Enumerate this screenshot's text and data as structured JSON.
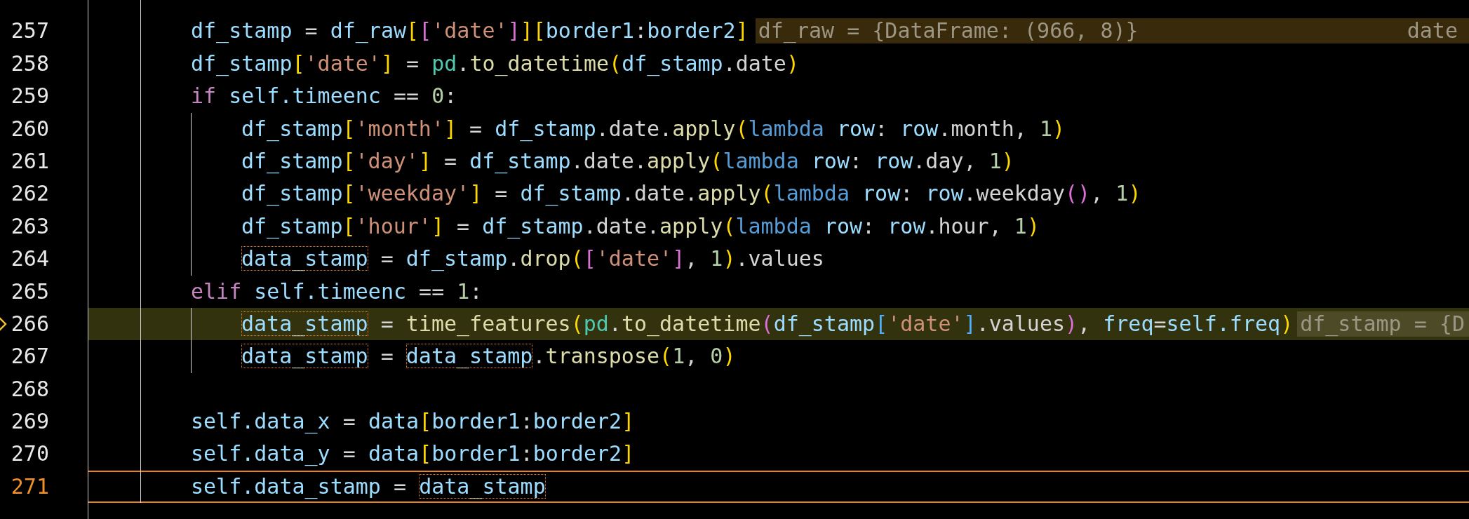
{
  "editor": {
    "lines": [
      {
        "current": false,
        "executing": false
      },
      {
        "number": "257",
        "current": false,
        "executing": false,
        "tokens": [
          {
            "text": "df_stamp",
            "kind": "var"
          },
          {
            "text": " = ",
            "kind": "plain"
          },
          {
            "text": "df_raw",
            "kind": "var"
          },
          {
            "text": "[",
            "kind": "b1"
          },
          {
            "text": "[",
            "kind": "b2"
          },
          {
            "text": "'date'",
            "kind": "str"
          },
          {
            "text": "]",
            "kind": "b2"
          },
          {
            "text": "]",
            "kind": "b1"
          },
          {
            "text": "[",
            "kind": "b1"
          },
          {
            "text": "border1",
            "kind": "var"
          },
          {
            "text": ":",
            "kind": "plain"
          },
          {
            "text": "border2",
            "kind": "var"
          },
          {
            "text": "]",
            "kind": "b1"
          }
        ],
        "hint": {
          "text": "df_raw = {DataFrame: (966, 8)}",
          "trailing": "date"
        }
      },
      {
        "number": "258",
        "current": false,
        "executing": false,
        "tokens": [
          {
            "text": "df_stamp",
            "kind": "var"
          },
          {
            "text": "[",
            "kind": "b1"
          },
          {
            "text": "'date'",
            "kind": "str"
          },
          {
            "text": "]",
            "kind": "b1"
          },
          {
            "text": " = ",
            "kind": "plain"
          },
          {
            "text": "pd",
            "kind": "cls"
          },
          {
            "text": ".",
            "kind": "plain"
          },
          {
            "text": "to_datetime",
            "kind": "fn"
          },
          {
            "text": "(",
            "kind": "b1"
          },
          {
            "text": "df_stamp",
            "kind": "var"
          },
          {
            "text": ".date",
            "kind": "plain"
          },
          {
            "text": ")",
            "kind": "b1"
          }
        ]
      },
      {
        "number": "259",
        "current": false,
        "executing": false,
        "tokens": [
          {
            "text": "if",
            "kind": "kw"
          },
          {
            "text": " self.timeenc",
            "kind": "var"
          },
          {
            "text": " == ",
            "kind": "plain"
          },
          {
            "text": "0",
            "kind": "num"
          },
          {
            "text": ":",
            "kind": "plain"
          }
        ],
        "children": [
          {
            "number": "260",
            "current": false,
            "executing": false,
            "tokens": [
              {
                "text": "df_stamp",
                "kind": "var"
              },
              {
                "text": "[",
                "kind": "b1"
              },
              {
                "text": "'month'",
                "kind": "str"
              },
              {
                "text": "]",
                "kind": "b1"
              },
              {
                "text": " = ",
                "kind": "plain"
              },
              {
                "text": "df_stamp",
                "kind": "var"
              },
              {
                "text": ".date.",
                "kind": "plain"
              },
              {
                "text": "apply",
                "kind": "fn"
              },
              {
                "text": "(",
                "kind": "b1"
              },
              {
                "text": "lambda",
                "kind": "storage"
              },
              {
                "text": " row",
                "kind": "var"
              },
              {
                "text": ": ",
                "kind": "plain"
              },
              {
                "text": "row",
                "kind": "var"
              },
              {
                "text": ".month, ",
                "kind": "plain"
              },
              {
                "text": "1",
                "kind": "num"
              },
              {
                "text": ")",
                "kind": "b1"
              }
            ]
          },
          {
            "number": "261",
            "current": false,
            "executing": false,
            "tokens": [
              {
                "text": "df_stamp",
                "kind": "var"
              },
              {
                "text": "[",
                "kind": "b1"
              },
              {
                "text": "'day'",
                "kind": "str"
              },
              {
                "text": "]",
                "kind": "b1"
              },
              {
                "text": " = ",
                "kind": "plain"
              },
              {
                "text": "df_stamp",
                "kind": "var"
              },
              {
                "text": ".date.",
                "kind": "plain"
              },
              {
                "text": "apply",
                "kind": "fn"
              },
              {
                "text": "(",
                "kind": "b1"
              },
              {
                "text": "lambda",
                "kind": "storage"
              },
              {
                "text": " row",
                "kind": "var"
              },
              {
                "text": ": ",
                "kind": "plain"
              },
              {
                "text": "row",
                "kind": "var"
              },
              {
                "text": ".day, ",
                "kind": "plain"
              },
              {
                "text": "1",
                "kind": "num"
              },
              {
                "text": ")",
                "kind": "b1"
              }
            ]
          },
          {
            "number": "262",
            "current": false,
            "executing": false,
            "tokens": [
              {
                "text": "df_stamp",
                "kind": "var"
              },
              {
                "text": "[",
                "kind": "b1"
              },
              {
                "text": "'weekday'",
                "kind": "str"
              },
              {
                "text": "]",
                "kind": "b1"
              },
              {
                "text": " = ",
                "kind": "plain"
              },
              {
                "text": "df_stamp",
                "kind": "var"
              },
              {
                "text": ".date.",
                "kind": "plain"
              },
              {
                "text": "apply",
                "kind": "fn"
              },
              {
                "text": "(",
                "kind": "b1"
              },
              {
                "text": "lambda",
                "kind": "storage"
              },
              {
                "text": " row",
                "kind": "var"
              },
              {
                "text": ": ",
                "kind": "plain"
              },
              {
                "text": "row",
                "kind": "var"
              },
              {
                "text": ".weekday",
                "kind": "plain"
              },
              {
                "text": "()",
                "kind": "b2"
              },
              {
                "text": ", ",
                "kind": "plain"
              },
              {
                "text": "1",
                "kind": "num"
              },
              {
                "text": ")",
                "kind": "b1"
              }
            ]
          },
          {
            "number": "263",
            "current": false,
            "executing": false,
            "tokens": [
              {
                "text": "df_stamp",
                "kind": "var"
              },
              {
                "text": "[",
                "kind": "b1"
              },
              {
                "text": "'hour'",
                "kind": "str"
              },
              {
                "text": "]",
                "kind": "b1"
              },
              {
                "text": " = ",
                "kind": "plain"
              },
              {
                "text": "df_stamp",
                "kind": "var"
              },
              {
                "text": ".date.",
                "kind": "plain"
              },
              {
                "text": "apply",
                "kind": "fn"
              },
              {
                "text": "(",
                "kind": "b1"
              },
              {
                "text": "lambda",
                "kind": "storage"
              },
              {
                "text": " row",
                "kind": "var"
              },
              {
                "text": ": ",
                "kind": "plain"
              },
              {
                "text": "row",
                "kind": "var"
              },
              {
                "text": ".hour, ",
                "kind": "plain"
              },
              {
                "text": "1",
                "kind": "num"
              },
              {
                "text": ")",
                "kind": "b1"
              }
            ]
          },
          {
            "number": "264",
            "current": false,
            "executing": false,
            "tokens": [
              {
                "text": "data_stamp",
                "kind": "var",
                "boxed": true
              },
              {
                "text": " = ",
                "kind": "plain"
              },
              {
                "text": "df_stamp",
                "kind": "var"
              },
              {
                "text": ".",
                "kind": "plain"
              },
              {
                "text": "drop",
                "kind": "fn"
              },
              {
                "text": "(",
                "kind": "b1"
              },
              {
                "text": "[",
                "kind": "b2"
              },
              {
                "text": "'date'",
                "kind": "str"
              },
              {
                "text": "]",
                "kind": "b2"
              },
              {
                "text": ", ",
                "kind": "plain"
              },
              {
                "text": "1",
                "kind": "num"
              },
              {
                "text": ")",
                "kind": "b1"
              },
              {
                "text": ".values",
                "kind": "plain"
              }
            ]
          }
        ]
      },
      {
        "number": "265",
        "current": false,
        "executing": false,
        "tokens": [
          {
            "text": "elif",
            "kind": "kw"
          },
          {
            "text": " self.timeenc",
            "kind": "var"
          },
          {
            "text": " == ",
            "kind": "plain"
          },
          {
            "text": "1",
            "kind": "num"
          },
          {
            "text": ":",
            "kind": "plain"
          }
        ],
        "children": [
          {
            "number": "266",
            "current": false,
            "executing": true,
            "tokens": [
              {
                "text": "data_stamp",
                "kind": "var",
                "boxed": true
              },
              {
                "text": " = ",
                "kind": "plain"
              },
              {
                "text": "time_features",
                "kind": "fn"
              },
              {
                "text": "(",
                "kind": "b1"
              },
              {
                "text": "pd",
                "kind": "cls"
              },
              {
                "text": ".",
                "kind": "plain"
              },
              {
                "text": "to_datetime",
                "kind": "fn"
              },
              {
                "text": "(",
                "kind": "b2"
              },
              {
                "text": "df_stamp",
                "kind": "var"
              },
              {
                "text": "[",
                "kind": "b3"
              },
              {
                "text": "'date'",
                "kind": "str"
              },
              {
                "text": "]",
                "kind": "b3"
              },
              {
                "text": ".values",
                "kind": "plain"
              },
              {
                "text": ")",
                "kind": "b2"
              },
              {
                "text": ", ",
                "kind": "plain"
              },
              {
                "text": "freq",
                "kind": "var"
              },
              {
                "text": "=",
                "kind": "plain"
              },
              {
                "text": "self.freq",
                "kind": "var"
              },
              {
                "text": ")",
                "kind": "b1"
              }
            ],
            "hint": {
              "text": "df_stamp = {D"
            }
          },
          {
            "number": "267",
            "current": false,
            "executing": false,
            "tokens": [
              {
                "text": "data_stamp",
                "kind": "var",
                "boxed": true
              },
              {
                "text": " = ",
                "kind": "plain"
              },
              {
                "text": "data_stamp",
                "kind": "var",
                "boxed": true
              },
              {
                "text": ".",
                "kind": "plain"
              },
              {
                "text": "transpose",
                "kind": "fn"
              },
              {
                "text": "(",
                "kind": "b1"
              },
              {
                "text": "1",
                "kind": "num"
              },
              {
                "text": ", ",
                "kind": "plain"
              },
              {
                "text": "0",
                "kind": "num"
              },
              {
                "text": ")",
                "kind": "b1"
              }
            ]
          }
        ]
      },
      {
        "number": "268",
        "current": false,
        "executing": false
      },
      {
        "number": "269",
        "current": false,
        "executing": false,
        "tokens": [
          {
            "text": "self.data_x",
            "kind": "var"
          },
          {
            "text": " = ",
            "kind": "plain"
          },
          {
            "text": "data",
            "kind": "var"
          },
          {
            "text": "[",
            "kind": "b1"
          },
          {
            "text": "border1",
            "kind": "var"
          },
          {
            "text": ":",
            "kind": "plain"
          },
          {
            "text": "border2",
            "kind": "var"
          },
          {
            "text": "]",
            "kind": "b1"
          }
        ]
      },
      {
        "number": "270",
        "current": false,
        "executing": false,
        "tokens": [
          {
            "text": "self.data_y",
            "kind": "var"
          },
          {
            "text": " = ",
            "kind": "plain"
          },
          {
            "text": "data",
            "kind": "var"
          },
          {
            "text": "[",
            "kind": "b1"
          },
          {
            "text": "border1",
            "kind": "var"
          },
          {
            "text": ":",
            "kind": "plain"
          },
          {
            "text": "border2",
            "kind": "var"
          },
          {
            "text": "]",
            "kind": "b1"
          }
        ]
      },
      {
        "number": "271",
        "current": true,
        "executing": false,
        "tokens": [
          {
            "text": "self.data_stamp",
            "kind": "var"
          },
          {
            "text": " = ",
            "kind": "plain"
          },
          {
            "text": "data_stamp",
            "kind": "var",
            "boxed": true
          }
        ]
      },
      {
        "current": false,
        "executing": false
      }
    ]
  }
}
